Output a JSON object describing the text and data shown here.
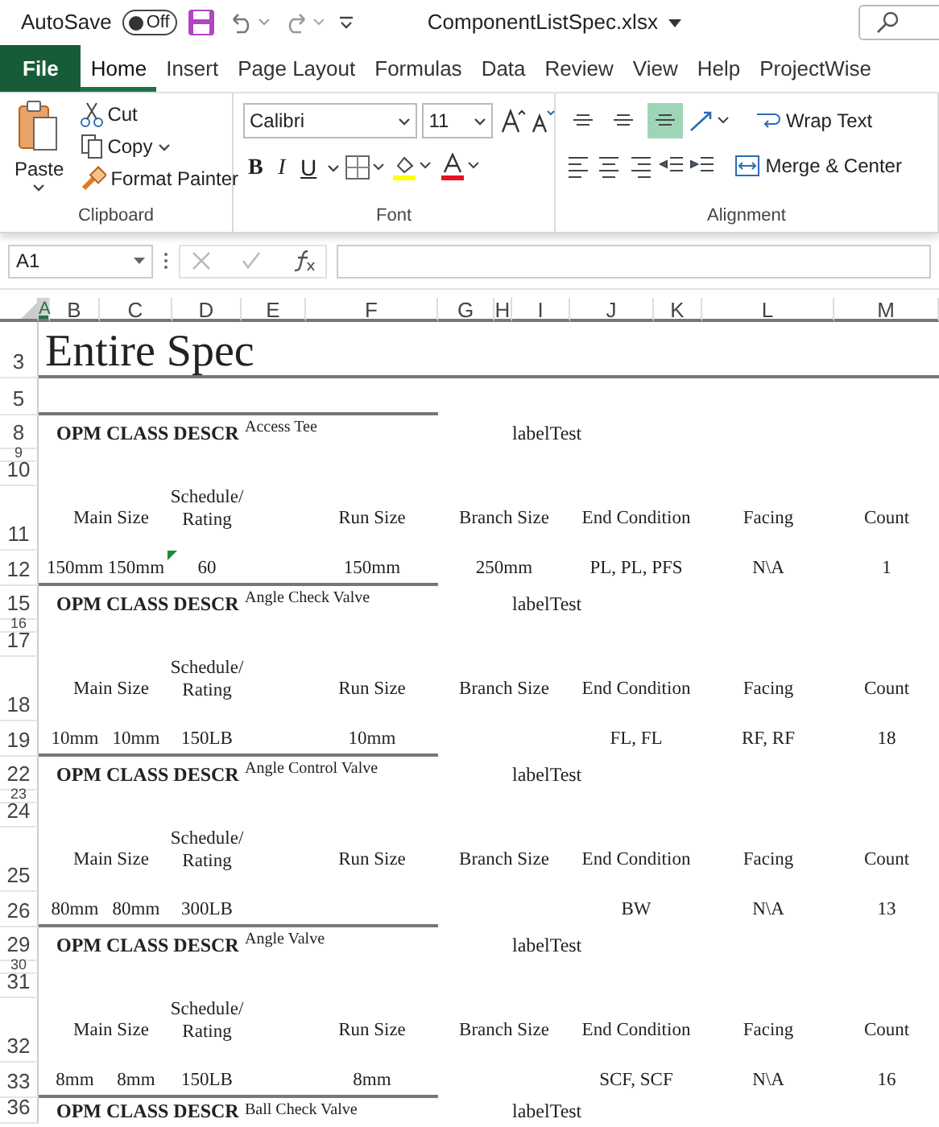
{
  "title_bar": {
    "autosave_label": "AutoSave",
    "autosave": {
      "on": false,
      "label": "Off"
    },
    "file_name": "ComponentListSpec.xlsx"
  },
  "ribbon_tabs": [
    {
      "label": "File",
      "kind": "file",
      "selected": false
    },
    {
      "label": "Home",
      "kind": "tab",
      "selected": true
    },
    {
      "label": "Insert",
      "kind": "tab",
      "selected": false
    },
    {
      "label": "Page Layout",
      "kind": "tab",
      "selected": false
    },
    {
      "label": "Formulas",
      "kind": "tab",
      "selected": false
    },
    {
      "label": "Data",
      "kind": "tab",
      "selected": false
    },
    {
      "label": "Review",
      "kind": "tab",
      "selected": false
    },
    {
      "label": "View",
      "kind": "tab",
      "selected": false
    },
    {
      "label": "Help",
      "kind": "tab",
      "selected": false
    },
    {
      "label": "ProjectWise",
      "kind": "tab",
      "selected": false
    }
  ],
  "ribbon": {
    "clipboard": {
      "title": "Clipboard",
      "paste": "Paste",
      "cut": "Cut",
      "copy": "Copy",
      "format_painter": "Format Painter"
    },
    "font": {
      "title": "Font",
      "font_name": "Calibri",
      "font_size": "11",
      "bold": "B",
      "italic": "I",
      "underline": "U"
    },
    "alignment": {
      "title": "Alignment",
      "vertical_align": [
        {
          "selected": false
        },
        {
          "selected": false
        },
        {
          "selected": true
        }
      ],
      "wrap_text": "Wrap Text",
      "merge_center": "Merge & Center"
    }
  },
  "formula_bar": {
    "name_box": "A1"
  },
  "sheet": {
    "columns": [
      {
        "label": "A",
        "selected": true
      },
      {
        "label": "B",
        "selected": false
      },
      {
        "label": "C",
        "selected": false
      },
      {
        "label": "D",
        "selected": false
      },
      {
        "label": "E",
        "selected": false
      },
      {
        "label": "F",
        "selected": false
      },
      {
        "label": "G",
        "selected": false
      },
      {
        "label": "H",
        "selected": false
      },
      {
        "label": "I",
        "selected": false
      },
      {
        "label": "J",
        "selected": false
      },
      {
        "label": "K",
        "selected": false
      },
      {
        "label": "L",
        "selected": false
      },
      {
        "label": "M",
        "selected": false
      }
    ],
    "rows": [
      {
        "number": "3",
        "kind": "title",
        "text": "Entire Spec"
      },
      {
        "number": "5",
        "kind": "rule"
      },
      {
        "number": "8",
        "kind": "class",
        "label": "OPM CLASS DESCR",
        "descr": "Access Tee",
        "tag": "labelTest"
      },
      {
        "number": "9",
        "kind": "gap"
      },
      {
        "number": "10",
        "kind": "blank"
      },
      {
        "number": "11",
        "kind": "header",
        "cells": [
          "Main Size",
          "Schedule/\nRating",
          "Run Size",
          "Branch Size",
          "End Condition",
          "Facing",
          "Count"
        ]
      },
      {
        "number": "12",
        "kind": "data",
        "flagged": true,
        "cells": [
          "150mm",
          "150mm",
          "60",
          "150mm",
          "250mm",
          "PL, PL, PFS",
          "N\\A",
          "1"
        ]
      },
      {
        "number": "15",
        "kind": "class",
        "label": "OPM CLASS DESCR",
        "descr": "Angle Check Valve",
        "tag": "labelTest"
      },
      {
        "number": "16",
        "kind": "gap"
      },
      {
        "number": "17",
        "kind": "blank"
      },
      {
        "number": "18",
        "kind": "header",
        "cells": [
          "Main Size",
          "Schedule/\nRating",
          "Run Size",
          "Branch Size",
          "End Condition",
          "Facing",
          "Count"
        ]
      },
      {
        "number": "19",
        "kind": "data",
        "flagged": false,
        "cells": [
          "10mm",
          "10mm",
          "150LB",
          "10mm",
          "",
          "FL, FL",
          "RF, RF",
          "18"
        ]
      },
      {
        "number": "22",
        "kind": "class",
        "label": "OPM CLASS DESCR",
        "descr": "Angle Control Valve",
        "tag": "labelTest"
      },
      {
        "number": "23",
        "kind": "gap"
      },
      {
        "number": "24",
        "kind": "blank"
      },
      {
        "number": "25",
        "kind": "header",
        "cells": [
          "Main Size",
          "Schedule/\nRating",
          "Run Size",
          "Branch Size",
          "End Condition",
          "Facing",
          "Count"
        ]
      },
      {
        "number": "26",
        "kind": "data",
        "flagged": false,
        "cells": [
          "80mm",
          "80mm",
          "300LB",
          "",
          "",
          "BW",
          "N\\A",
          "13"
        ]
      },
      {
        "number": "29",
        "kind": "class",
        "label": "OPM CLASS DESCR",
        "descr": "Angle Valve",
        "tag": "labelTest"
      },
      {
        "number": "30",
        "kind": "gap"
      },
      {
        "number": "31",
        "kind": "blank"
      },
      {
        "number": "32",
        "kind": "header",
        "cells": [
          "Main Size",
          "Schedule/\nRating",
          "Run Size",
          "Branch Size",
          "End Condition",
          "Facing",
          "Count"
        ]
      },
      {
        "number": "33",
        "kind": "data",
        "flagged": false,
        "cells": [
          "8mm",
          "8mm",
          "150LB",
          "8mm",
          "",
          "SCF, SCF",
          "N\\A",
          "16"
        ]
      },
      {
        "number": "36",
        "kind": "class",
        "label": "OPM CLASS DESCR",
        "descr": "Ball Check Valve",
        "tag": "labelTest"
      }
    ]
  }
}
